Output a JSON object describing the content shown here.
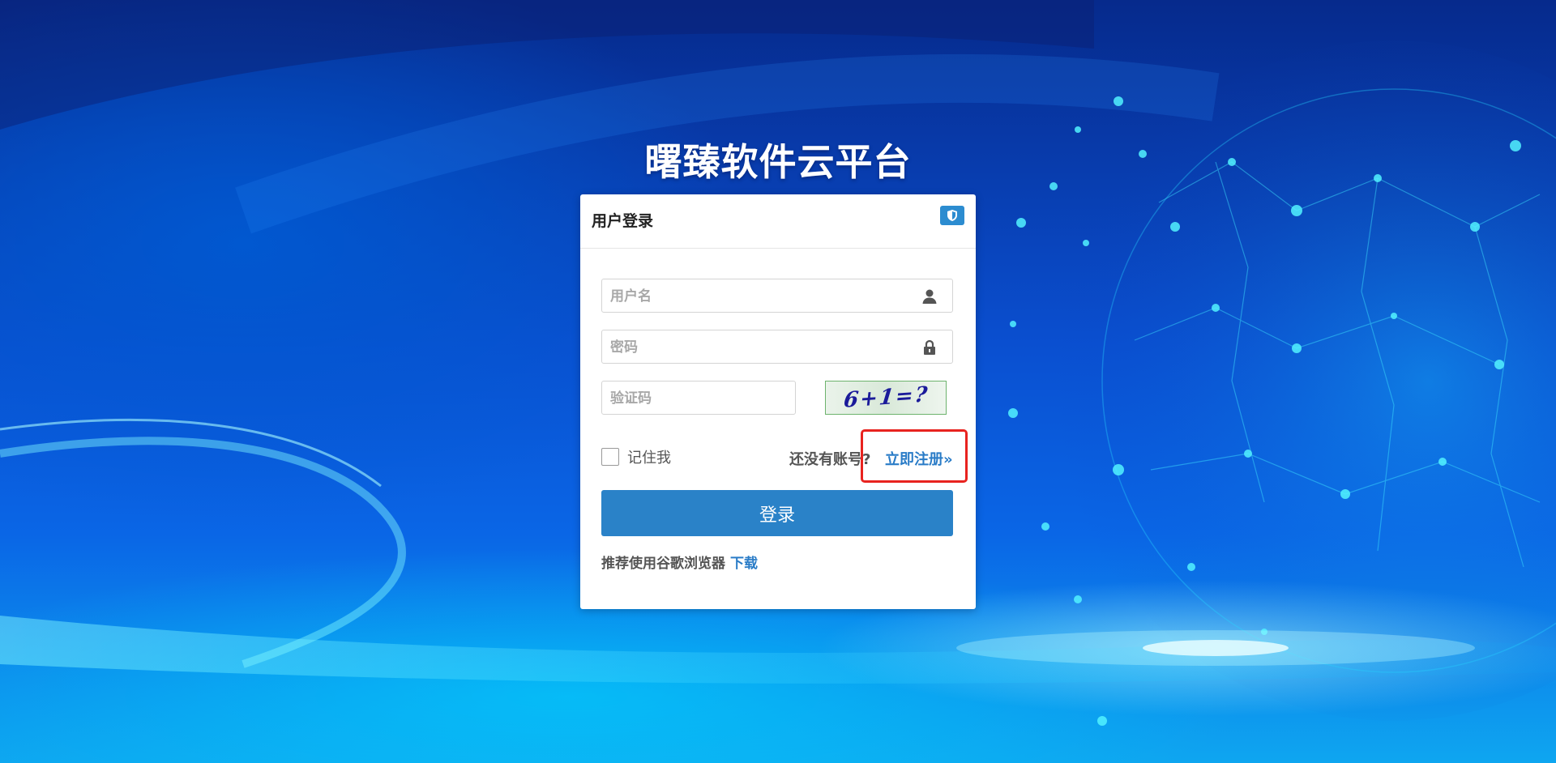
{
  "page": {
    "title": "曙臻软件云平台"
  },
  "login_card": {
    "header_title": "用户登录",
    "header_badge_icon": "shield-icon",
    "username_placeholder": "用户名",
    "username_icon": "user-icon",
    "password_placeholder": "密码",
    "password_icon": "lock-icon",
    "captcha_placeholder": "验证码",
    "captcha_image_text": "6+1=?",
    "remember_label": "记住我",
    "remember_checked": false,
    "no_account_text": "还没有账号?",
    "register_link": "立即注册»",
    "login_button": "登录",
    "browser_tip": "推荐使用谷歌浏览器",
    "download_link": "下载"
  },
  "colors": {
    "accent": "#2a82c8",
    "link": "#2a7cc7",
    "highlight": "#e8231f",
    "background_top": "#062a8c",
    "background_bottom": "#0ea6f0"
  }
}
